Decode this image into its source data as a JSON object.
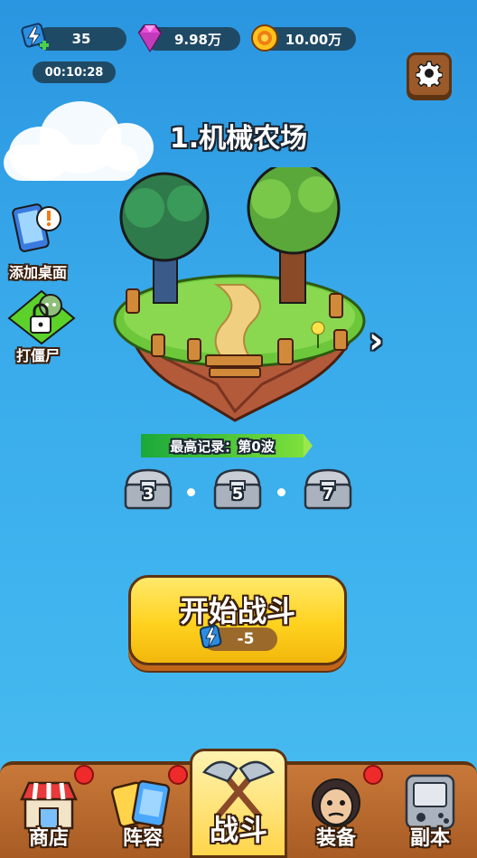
{
  "resources": {
    "energy": "35",
    "gems": "9.98万",
    "coins": "10.00万",
    "timer": "00:10:28"
  },
  "level": {
    "title": "1.机械农场",
    "record": "最高记录：第0波"
  },
  "side_buttons": {
    "add_desktop": "添加桌面",
    "zombie": "打僵尸"
  },
  "chests": [
    "3",
    "5",
    "7"
  ],
  "start": {
    "label": "开始战斗",
    "cost": "-5"
  },
  "nav": {
    "shop": "商店",
    "lineup": "阵容",
    "battle": "战斗",
    "equip": "装备",
    "dungeon": "副本"
  },
  "colors": {
    "sky": "#38a9ea",
    "wood": "#a85c24",
    "button_yellow": "#ffd21f",
    "record_green": "#1aa83a",
    "notify_red": "#ee2a2a"
  }
}
